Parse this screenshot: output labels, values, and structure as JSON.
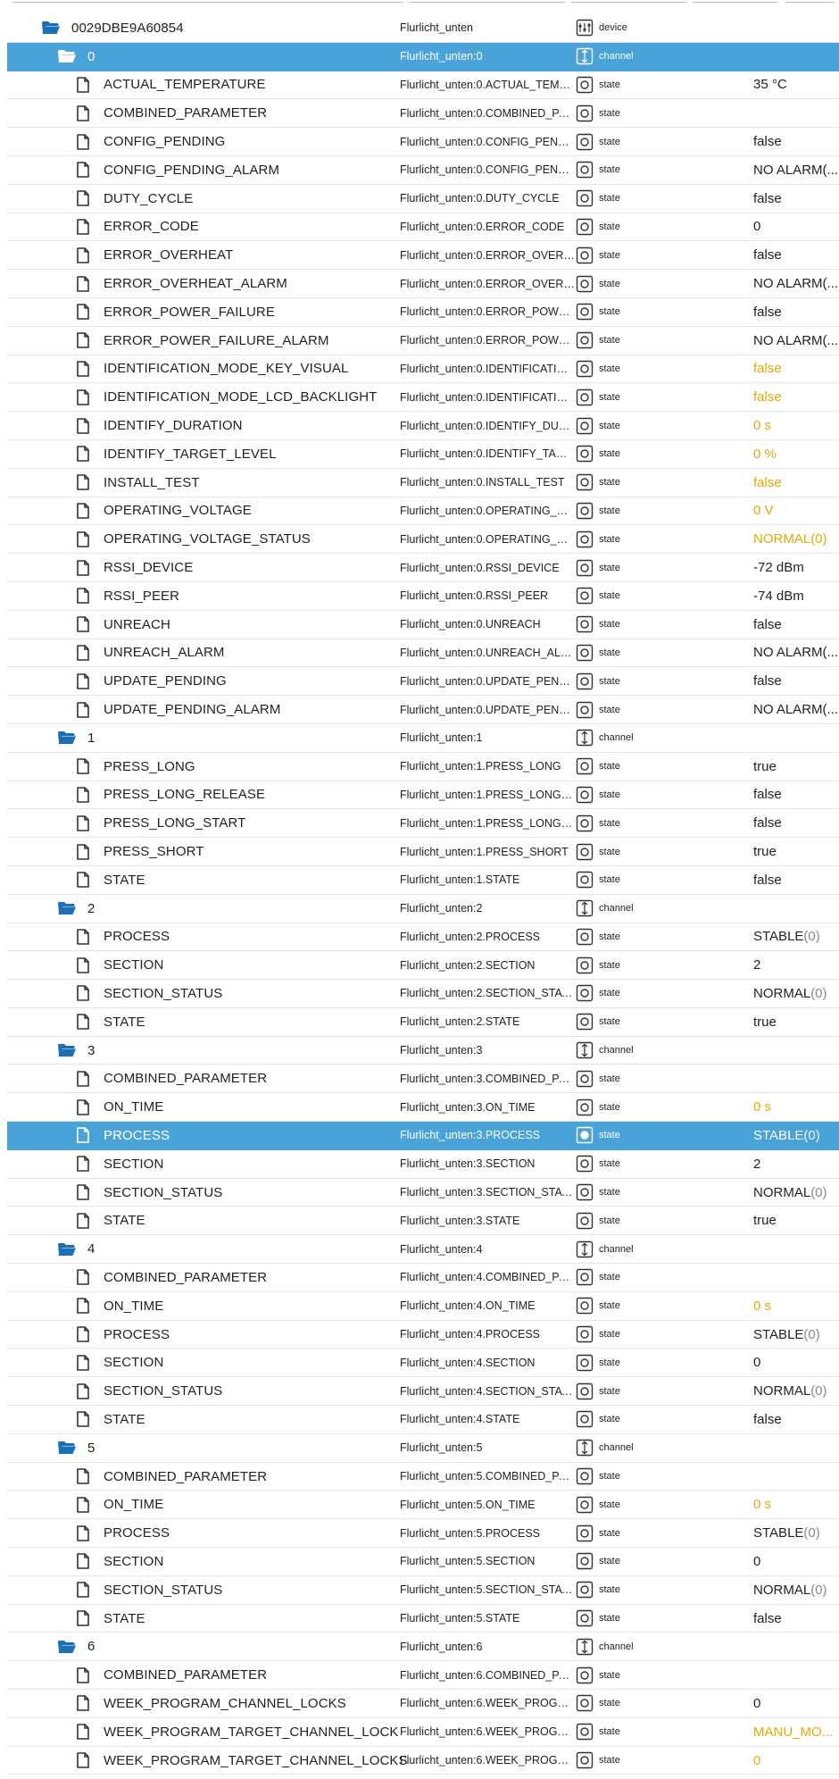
{
  "rows": [
    {
      "name": "0029DBE9A60854",
      "kind": "folder",
      "level": 0,
      "oid": "Flurlicht_unten",
      "type": "device",
      "icon": "device-icon"
    },
    {
      "name": "0",
      "kind": "folder",
      "level": 1,
      "oid": "Flurlicht_unten:0",
      "type": "channel",
      "icon": "channel-icon",
      "selected": true
    },
    {
      "name": "ACTUAL_TEMPERATURE",
      "kind": "file",
      "level": 2,
      "oid": "Flurlicht_unten:0.ACTUAL_TEMPERATURE",
      "type": "state",
      "value": "35 °C"
    },
    {
      "name": "COMBINED_PARAMETER",
      "kind": "file",
      "level": 2,
      "oid": "Flurlicht_unten:0.COMBINED_PARAMETER",
      "type": "state"
    },
    {
      "name": "CONFIG_PENDING",
      "kind": "file",
      "level": 2,
      "oid": "Flurlicht_unten:0.CONFIG_PENDING",
      "type": "state",
      "value": "false"
    },
    {
      "name": "CONFIG_PENDING_ALARM",
      "kind": "file",
      "level": 2,
      "oid": "Flurlicht_unten:0.CONFIG_PENDING_ALARM",
      "type": "state",
      "value": "NO ALARM(...",
      "vmute": ""
    },
    {
      "name": "DUTY_CYCLE",
      "kind": "file",
      "level": 2,
      "oid": "Flurlicht_unten:0.DUTY_CYCLE",
      "type": "state",
      "value": "false"
    },
    {
      "name": "ERROR_CODE",
      "kind": "file",
      "level": 2,
      "oid": "Flurlicht_unten:0.ERROR_CODE",
      "type": "state",
      "value": "0"
    },
    {
      "name": "ERROR_OVERHEAT",
      "kind": "file",
      "level": 2,
      "oid": "Flurlicht_unten:0.ERROR_OVERHEAT",
      "type": "state",
      "value": "false"
    },
    {
      "name": "ERROR_OVERHEAT_ALARM",
      "kind": "file",
      "level": 2,
      "oid": "Flurlicht_unten:0.ERROR_OVERHEAT_ALARM",
      "type": "state",
      "value": "NO ALARM(..."
    },
    {
      "name": "ERROR_POWER_FAILURE",
      "kind": "file",
      "level": 2,
      "oid": "Flurlicht_unten:0.ERROR_POWER_FAILURE",
      "type": "state",
      "value": "false"
    },
    {
      "name": "ERROR_POWER_FAILURE_ALARM",
      "kind": "file",
      "level": 2,
      "oid": "Flurlicht_unten:0.ERROR_POWER_FAILURE_ALARM",
      "type": "state",
      "value": "NO ALARM(..."
    },
    {
      "name": "IDENTIFICATION_MODE_KEY_VISUAL",
      "kind": "file",
      "level": 2,
      "oid": "Flurlicht_unten:0.IDENTIFICATION_MODE_KEY_VISUAL",
      "type": "state",
      "value": "false",
      "orange": true
    },
    {
      "name": "IDENTIFICATION_MODE_LCD_BACKLIGHT",
      "kind": "file",
      "level": 2,
      "oid": "Flurlicht_unten:0.IDENTIFICATION_MODE_LCD_BACKLIGHT",
      "type": "state",
      "value": "false",
      "orange": true
    },
    {
      "name": "IDENTIFY_DURATION",
      "kind": "file",
      "level": 2,
      "oid": "Flurlicht_unten:0.IDENTIFY_DURATION",
      "type": "state",
      "value": "0 s",
      "orange": true
    },
    {
      "name": "IDENTIFY_TARGET_LEVEL",
      "kind": "file",
      "level": 2,
      "oid": "Flurlicht_unten:0.IDENTIFY_TARGET_LEVEL",
      "type": "state",
      "value": "0 %",
      "orange": true
    },
    {
      "name": "INSTALL_TEST",
      "kind": "file",
      "level": 2,
      "oid": "Flurlicht_unten:0.INSTALL_TEST",
      "type": "state",
      "value": "false",
      "orange": true
    },
    {
      "name": "OPERATING_VOLTAGE",
      "kind": "file",
      "level": 2,
      "oid": "Flurlicht_unten:0.OPERATING_VOLTAGE",
      "type": "state",
      "value": "0 V",
      "orange": true
    },
    {
      "name": "OPERATING_VOLTAGE_STATUS",
      "kind": "file",
      "level": 2,
      "oid": "Flurlicht_unten:0.OPERATING_VOLTAGE_STATUS",
      "type": "state",
      "value": "NORMAL",
      "vmute": "(0)",
      "orange": true
    },
    {
      "name": "RSSI_DEVICE",
      "kind": "file",
      "level": 2,
      "oid": "Flurlicht_unten:0.RSSI_DEVICE",
      "type": "state",
      "value": "-72 dBm"
    },
    {
      "name": "RSSI_PEER",
      "kind": "file",
      "level": 2,
      "oid": "Flurlicht_unten:0.RSSI_PEER",
      "type": "state",
      "value": "-74 dBm"
    },
    {
      "name": "UNREACH",
      "kind": "file",
      "level": 2,
      "oid": "Flurlicht_unten:0.UNREACH",
      "type": "state",
      "value": "false"
    },
    {
      "name": "UNREACH_ALARM",
      "kind": "file",
      "level": 2,
      "oid": "Flurlicht_unten:0.UNREACH_ALARM",
      "type": "state",
      "value": "NO ALARM(..."
    },
    {
      "name": "UPDATE_PENDING",
      "kind": "file",
      "level": 2,
      "oid": "Flurlicht_unten:0.UPDATE_PENDING",
      "type": "state",
      "value": "false"
    },
    {
      "name": "UPDATE_PENDING_ALARM",
      "kind": "file",
      "level": 2,
      "oid": "Flurlicht_unten:0.UPDATE_PENDING_ALARM",
      "type": "state",
      "value": "NO ALARM(..."
    },
    {
      "name": "1",
      "kind": "folder",
      "level": 1,
      "oid": "Flurlicht_unten:1",
      "type": "channel",
      "icon": "channel-icon"
    },
    {
      "name": "PRESS_LONG",
      "kind": "file",
      "level": 2,
      "oid": "Flurlicht_unten:1.PRESS_LONG",
      "type": "state",
      "value": "true"
    },
    {
      "name": "PRESS_LONG_RELEASE",
      "kind": "file",
      "level": 2,
      "oid": "Flurlicht_unten:1.PRESS_LONG_RELEASE",
      "type": "state",
      "value": "false"
    },
    {
      "name": "PRESS_LONG_START",
      "kind": "file",
      "level": 2,
      "oid": "Flurlicht_unten:1.PRESS_LONG_START",
      "type": "state",
      "value": "false"
    },
    {
      "name": "PRESS_SHORT",
      "kind": "file",
      "level": 2,
      "oid": "Flurlicht_unten:1.PRESS_SHORT",
      "type": "state",
      "value": "true"
    },
    {
      "name": "STATE",
      "kind": "file",
      "level": 2,
      "oid": "Flurlicht_unten:1.STATE",
      "type": "state",
      "value": "false"
    },
    {
      "name": "2",
      "kind": "folder",
      "level": 1,
      "oid": "Flurlicht_unten:2",
      "type": "channel",
      "icon": "channel-icon"
    },
    {
      "name": "PROCESS",
      "kind": "file",
      "level": 2,
      "oid": "Flurlicht_unten:2.PROCESS",
      "type": "state",
      "value": "STABLE",
      "vmute": "(0)"
    },
    {
      "name": "SECTION",
      "kind": "file",
      "level": 2,
      "oid": "Flurlicht_unten:2.SECTION",
      "type": "state",
      "value": "2"
    },
    {
      "name": "SECTION_STATUS",
      "kind": "file",
      "level": 2,
      "oid": "Flurlicht_unten:2.SECTION_STATUS",
      "type": "state",
      "value": "NORMAL",
      "vmute": "(0)"
    },
    {
      "name": "STATE",
      "kind": "file",
      "level": 2,
      "oid": "Flurlicht_unten:2.STATE",
      "type": "state",
      "value": "true"
    },
    {
      "name": "3",
      "kind": "folder",
      "level": 1,
      "oid": "Flurlicht_unten:3",
      "type": "channel",
      "icon": "channel-icon"
    },
    {
      "name": "COMBINED_PARAMETER",
      "kind": "file",
      "level": 2,
      "oid": "Flurlicht_unten:3.COMBINED_PARAMETER",
      "type": "state"
    },
    {
      "name": "ON_TIME",
      "kind": "file",
      "level": 2,
      "oid": "Flurlicht_unten:3.ON_TIME",
      "type": "state",
      "value": "0 s",
      "orange": true
    },
    {
      "name": "PROCESS",
      "kind": "file",
      "level": 2,
      "oid": "Flurlicht_unten:3.PROCESS",
      "type": "state",
      "value": "STABLE",
      "vmute": "(0)",
      "selected": true
    },
    {
      "name": "SECTION",
      "kind": "file",
      "level": 2,
      "oid": "Flurlicht_unten:3.SECTION",
      "type": "state",
      "value": "2"
    },
    {
      "name": "SECTION_STATUS",
      "kind": "file",
      "level": 2,
      "oid": "Flurlicht_unten:3.SECTION_STATUS",
      "type": "state",
      "value": "NORMAL",
      "vmute": "(0)"
    },
    {
      "name": "STATE",
      "kind": "file",
      "level": 2,
      "oid": "Flurlicht_unten:3.STATE",
      "type": "state",
      "value": "true"
    },
    {
      "name": "4",
      "kind": "folder",
      "level": 1,
      "oid": "Flurlicht_unten:4",
      "type": "channel",
      "icon": "channel-icon"
    },
    {
      "name": "COMBINED_PARAMETER",
      "kind": "file",
      "level": 2,
      "oid": "Flurlicht_unten:4.COMBINED_PARAMETER",
      "type": "state"
    },
    {
      "name": "ON_TIME",
      "kind": "file",
      "level": 2,
      "oid": "Flurlicht_unten:4.ON_TIME",
      "type": "state",
      "value": "0 s",
      "orange": true
    },
    {
      "name": "PROCESS",
      "kind": "file",
      "level": 2,
      "oid": "Flurlicht_unten:4.PROCESS",
      "type": "state",
      "value": "STABLE",
      "vmute": "(0)"
    },
    {
      "name": "SECTION",
      "kind": "file",
      "level": 2,
      "oid": "Flurlicht_unten:4.SECTION",
      "type": "state",
      "value": "0"
    },
    {
      "name": "SECTION_STATUS",
      "kind": "file",
      "level": 2,
      "oid": "Flurlicht_unten:4.SECTION_STATUS",
      "type": "state",
      "value": "NORMAL",
      "vmute": "(0)"
    },
    {
      "name": "STATE",
      "kind": "file",
      "level": 2,
      "oid": "Flurlicht_unten:4.STATE",
      "type": "state",
      "value": "false"
    },
    {
      "name": "5",
      "kind": "folder",
      "level": 1,
      "oid": "Flurlicht_unten:5",
      "type": "channel",
      "icon": "channel-icon"
    },
    {
      "name": "COMBINED_PARAMETER",
      "kind": "file",
      "level": 2,
      "oid": "Flurlicht_unten:5.COMBINED_PARAMETER",
      "type": "state"
    },
    {
      "name": "ON_TIME",
      "kind": "file",
      "level": 2,
      "oid": "Flurlicht_unten:5.ON_TIME",
      "type": "state",
      "value": "0 s",
      "orange": true
    },
    {
      "name": "PROCESS",
      "kind": "file",
      "level": 2,
      "oid": "Flurlicht_unten:5.PROCESS",
      "type": "state",
      "value": "STABLE",
      "vmute": "(0)"
    },
    {
      "name": "SECTION",
      "kind": "file",
      "level": 2,
      "oid": "Flurlicht_unten:5.SECTION",
      "type": "state",
      "value": "0"
    },
    {
      "name": "SECTION_STATUS",
      "kind": "file",
      "level": 2,
      "oid": "Flurlicht_unten:5.SECTION_STATUS",
      "type": "state",
      "value": "NORMAL",
      "vmute": "(0)"
    },
    {
      "name": "STATE",
      "kind": "file",
      "level": 2,
      "oid": "Flurlicht_unten:5.STATE",
      "type": "state",
      "value": "false"
    },
    {
      "name": "6",
      "kind": "folder",
      "level": 1,
      "oid": "Flurlicht_unten:6",
      "type": "channel",
      "icon": "channel-icon"
    },
    {
      "name": "COMBINED_PARAMETER",
      "kind": "file",
      "level": 2,
      "oid": "Flurlicht_unten:6.COMBINED_PARAMETER",
      "type": "state"
    },
    {
      "name": "WEEK_PROGRAM_CHANNEL_LOCKS",
      "kind": "file",
      "level": 2,
      "oid": "Flurlicht_unten:6.WEEK_PROGRAM_CHANNEL_LOCKS",
      "type": "state",
      "value": "0"
    },
    {
      "name": "WEEK_PROGRAM_TARGET_CHANNEL_LOCK",
      "kind": "file",
      "level": 2,
      "oid": "Flurlicht_unten:6.WEEK_PROGRAM_TARGET_CHANNEL_LOCK",
      "type": "state",
      "value": "MANU_MO...",
      "orange": true
    },
    {
      "name": "WEEK_PROGRAM_TARGET_CHANNEL_LOCKS",
      "kind": "file",
      "level": 2,
      "oid": "Flurlicht_unten:6.WEEK_PROGRAM_TARGET_CHANNEL_LOCKS",
      "type": "state",
      "value": "0",
      "orange": true
    }
  ],
  "colors": {
    "accent": "#4aa3d8",
    "folder": "#1a6fb5",
    "orange_value": "#e8a800",
    "muted": "#8a8a8a"
  }
}
